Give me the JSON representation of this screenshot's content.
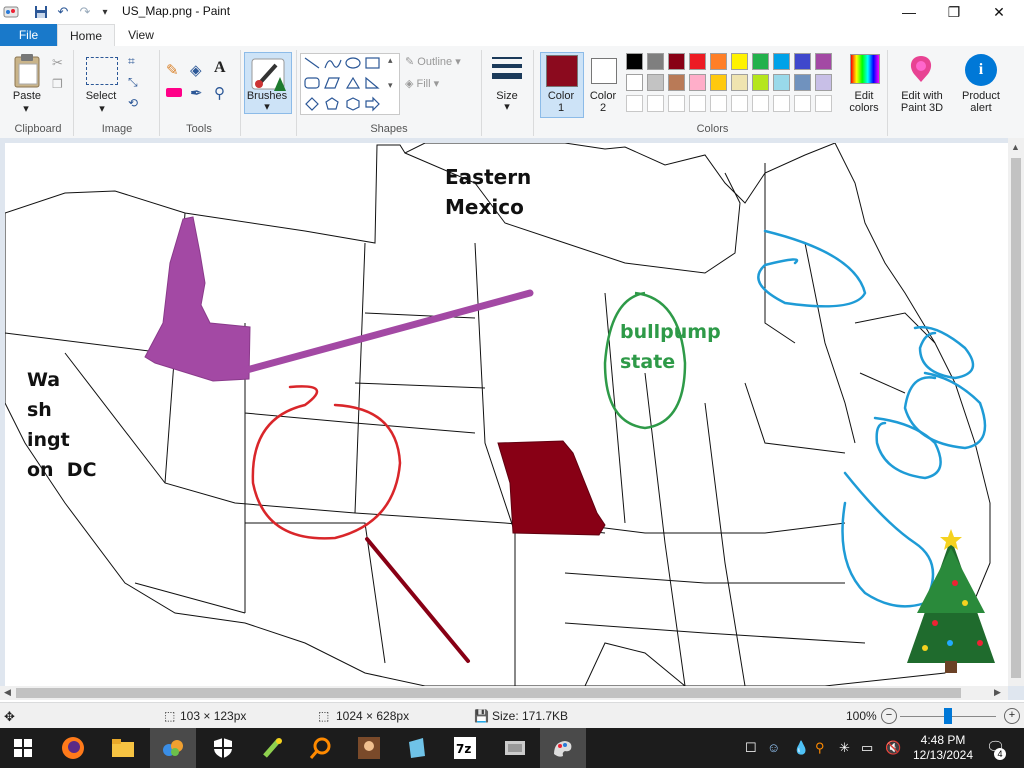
{
  "window": {
    "title": "US_Map.png - Paint",
    "controls": [
      "—",
      "❐",
      "✕"
    ]
  },
  "tabs": {
    "file": "File",
    "home": "Home",
    "view": "View"
  },
  "ribbon": {
    "clipboard": {
      "paste": "Paste",
      "group": "Clipboard"
    },
    "image": {
      "select": "Select",
      "group": "Image"
    },
    "tools": {
      "group": "Tools"
    },
    "brushes": {
      "label": "Brushes"
    },
    "shapes": {
      "outline": "Outline",
      "fill": "Fill",
      "group": "Shapes"
    },
    "size": {
      "label": "Size"
    },
    "color1": {
      "label_line1": "Color",
      "label_line2": "1",
      "value": "#8b0a1e"
    },
    "color2": {
      "label_line1": "Color",
      "label_line2": "2",
      "value": "#ffffff"
    },
    "colors": {
      "group": "Colors",
      "row1": [
        "#000000",
        "#7f7f7f",
        "#880015",
        "#ed1c24",
        "#ff7f27",
        "#fff200",
        "#22b14c",
        "#00a2e8",
        "#3f48cc",
        "#a349a4"
      ],
      "row2": [
        "#ffffff",
        "#c3c3c3",
        "#b97a57",
        "#ffaec9",
        "#ffc90e",
        "#efe4b0",
        "#b5e61d",
        "#99d9ea",
        "#7092be",
        "#c8bfe7"
      ]
    },
    "edit_colors": {
      "line1": "Edit",
      "line2": "colors"
    },
    "paint3d": {
      "line1": "Edit with",
      "line2": "Paint 3D"
    },
    "product_alert": {
      "line1": "Product",
      "line2": "alert"
    }
  },
  "canvas": {
    "label_eastern": "Eastern",
    "label_mexico": "Mexico",
    "label_bullpump": "bullpump",
    "label_state": "state",
    "label_wa": "Wa",
    "label_sh": "sh",
    "label_ingt": "ingt",
    "label_ondc": "on  DC"
  },
  "status": {
    "selection_size": "103 × 123px",
    "image_size": "1024 × 628px",
    "file_size": "Size: 171.7KB",
    "zoom": "100%",
    "zoom_level": 0.5
  },
  "taskbar": {
    "time": "4:48 PM",
    "date": "12/13/2024",
    "notification_count": "4"
  },
  "icons": {
    "save": "save-icon",
    "undo": "undo-icon",
    "redo": "redo-icon",
    "start": "windows-start-icon",
    "firefox": "firefox-icon",
    "explorer": "folder-icon"
  }
}
